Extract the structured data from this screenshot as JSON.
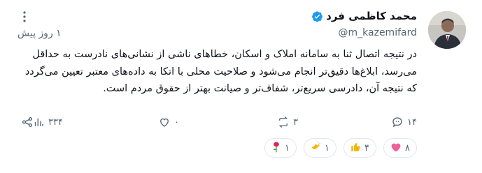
{
  "author": {
    "name": "محمد کاظمی فرد",
    "handle": "@m_kazemifard"
  },
  "meta": {
    "time": "۱ روز پیش"
  },
  "tweet": {
    "text": "در نتیجه اتصال ثنا به سامانه املاک و اسکان، خطاهای ناشی از نشانی‌های نادرست به حداقل می‌رسد، ابلاغ‌ها دقیق‌تر انجام می‌شود و صلاحیت محلی با اتکا به داده‌های معتبر تعیین می‌گردد که نتیجه آن، دادرسی سریع‌تر، شفاف‌تر و صیانت بهتر از حقوق مردم است."
  },
  "actions": {
    "replies": "۱۴",
    "retweets": "۳",
    "likes": "۰",
    "views": "۳۳۴"
  },
  "reactions": [
    {
      "emoji": "💗",
      "count": "۸"
    },
    {
      "emoji": "👍",
      "count": "۴"
    },
    {
      "emoji": "👏",
      "count": "۱"
    },
    {
      "emoji": "🌹",
      "count": "۱"
    }
  ],
  "colors": {
    "verified": "#1d9bf0",
    "muted": "#536471"
  }
}
